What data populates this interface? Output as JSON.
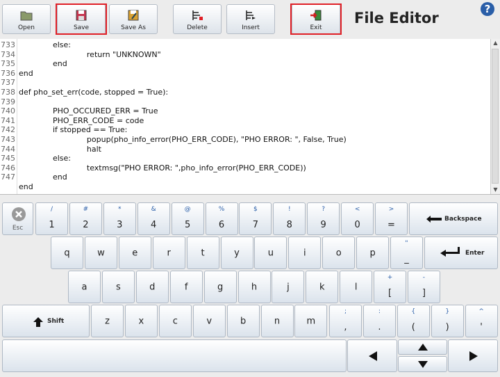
{
  "toolbar": {
    "open": "Open",
    "save": "Save",
    "save_as": "Save As",
    "delete": "Delete",
    "insert": "Insert",
    "exit": "Exit",
    "title": "File Editor",
    "help": "?",
    "highlight_color": "#e01f26"
  },
  "editor": {
    "lines": [
      {
        "num": "733",
        "text": "              else:"
      },
      {
        "num": "734",
        "text": "                            return \"UNKNOWN\""
      },
      {
        "num": "735",
        "text": "              end"
      },
      {
        "num": "736",
        "text": "end"
      },
      {
        "num": "737",
        "text": ""
      },
      {
        "num": "738",
        "text": "def pho_set_err(code, stopped = True):"
      },
      {
        "num": "739",
        "text": ""
      },
      {
        "num": "740",
        "text": "              PHO_OCCURED_ERR = True"
      },
      {
        "num": "741",
        "text": "              PHO_ERR_CODE = code"
      },
      {
        "num": "742",
        "text": "              if stopped == True:"
      },
      {
        "num": "743",
        "text": "                            popup(pho_info_error(PHO_ERR_CODE), \"PHO ERROR: \", False, True)"
      },
      {
        "num": "744",
        "text": "                            halt"
      },
      {
        "num": "745",
        "text": "              else:"
      },
      {
        "num": "746",
        "text": "                            textmsg(\"PHO ERROR: \",pho_info_error(PHO_ERR_CODE))"
      },
      {
        "num": "747",
        "text": "              end"
      },
      {
        "num": "",
        "text": "end"
      }
    ]
  },
  "keyboard": {
    "esc": "Esc",
    "backspace": "Backspace",
    "enter": "Enter",
    "shift": "Shift",
    "row1": [
      {
        "sub": "/",
        "main": "1"
      },
      {
        "sub": "#",
        "main": "2"
      },
      {
        "sub": "*",
        "main": "3"
      },
      {
        "sub": "&",
        "main": "4"
      },
      {
        "sub": "@",
        "main": "5"
      },
      {
        "sub": "%",
        "main": "6"
      },
      {
        "sub": "$",
        "main": "7"
      },
      {
        "sub": "!",
        "main": "8"
      },
      {
        "sub": "?",
        "main": "9"
      },
      {
        "sub": "<",
        "main": "0"
      },
      {
        "sub": ">",
        "main": "="
      }
    ],
    "row2": [
      "q",
      "w",
      "e",
      "r",
      "t",
      "y",
      "u",
      "i",
      "o",
      "p"
    ],
    "row2_extra": {
      "sub": "\"",
      "main": "_"
    },
    "row3": [
      "a",
      "s",
      "d",
      "f",
      "g",
      "h",
      "j",
      "k",
      "l"
    ],
    "row3_extra": [
      {
        "sub": "+",
        "main": "["
      },
      {
        "sub": "-",
        "main": "]"
      }
    ],
    "row4": [
      "z",
      "x",
      "c",
      "v",
      "b",
      "n",
      "m"
    ],
    "row4_extra": [
      {
        "sub": ";",
        "main": ","
      },
      {
        "sub": ":",
        "main": "."
      },
      {
        "sub": "{",
        "main": "("
      },
      {
        "sub": "}",
        "main": ")"
      },
      {
        "sub": "^",
        "main": "'"
      }
    ]
  }
}
